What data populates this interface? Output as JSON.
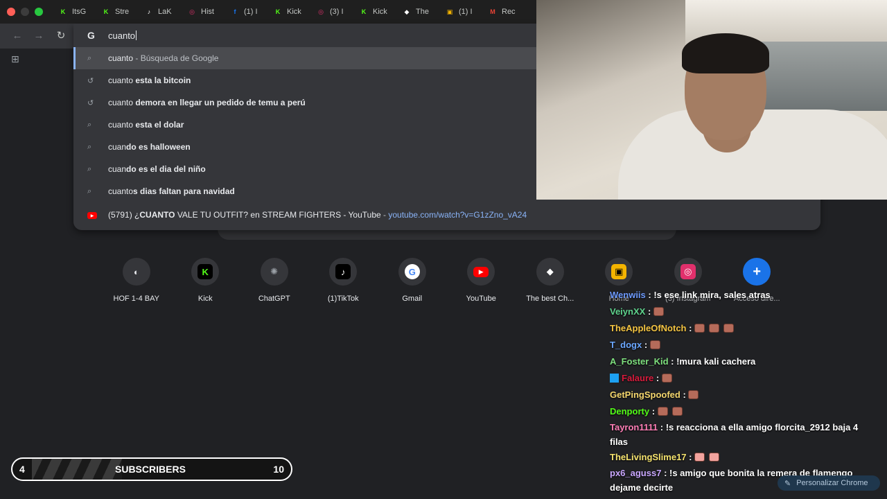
{
  "browser": {
    "tabs": [
      {
        "label": "ItsG",
        "icon": "kick-icon",
        "color": "#53fc18"
      },
      {
        "label": "Stre",
        "icon": "kick-icon",
        "color": "#53fc18"
      },
      {
        "label": "LaK",
        "icon": "tiktok-icon",
        "color": "#ffffff"
      },
      {
        "label": "Hist",
        "icon": "instagram-icon",
        "color": "#e1306c"
      },
      {
        "label": "(1) I",
        "icon": "facebook-icon",
        "color": "#1877f2"
      },
      {
        "label": "Kick",
        "icon": "kick-icon",
        "color": "#53fc18"
      },
      {
        "label": "(3) I",
        "icon": "instagram-icon",
        "color": "#e1306c"
      },
      {
        "label": "Kick",
        "icon": "kick-icon",
        "color": "#53fc18"
      },
      {
        "label": "The",
        "icon": "diamond-icon",
        "color": "#ffffff"
      },
      {
        "label": "(1) I",
        "icon": "clapper-icon",
        "color": "#f4b400"
      },
      {
        "label": "Rec",
        "icon": "gmail-icon",
        "color": "#ea4335"
      }
    ],
    "omnibox": {
      "query": "cuanto",
      "suggestions": [
        {
          "icon": "search-icon",
          "prefix": "cuanto",
          "rest": "",
          "suffix": " - Búsqueda de Google",
          "selected": true
        },
        {
          "icon": "history-icon",
          "prefix": "cuanto",
          "rest": " esta la bitcoin",
          "suffix": "",
          "selected": false
        },
        {
          "icon": "history-icon",
          "prefix": "cuanto",
          "rest": " demora en llegar un pedido de temu a perú",
          "suffix": "",
          "selected": false
        },
        {
          "icon": "search-icon",
          "prefix": "cuanto",
          "rest": " esta el dolar",
          "suffix": "",
          "selected": false
        },
        {
          "icon": "search-icon",
          "prefix": "cuan",
          "rest": "do es halloween",
          "suffix": "",
          "selected": false
        },
        {
          "icon": "search-icon",
          "prefix": "cuan",
          "rest": "do es el dia del niño",
          "suffix": "",
          "selected": false
        },
        {
          "icon": "search-icon",
          "prefix": "cuanto",
          "rest": "s dias faltan para navidad",
          "suffix": "",
          "selected": false
        }
      ],
      "history_result": {
        "title_before": "(5791) ¿",
        "title_bold": "CUANTO",
        "title_after": " VALE TU OUTFIT? en STREAM FIGHTERS - YouTube",
        "separator": " - ",
        "url": "youtube.com/watch?v=G1zZno_vA24"
      }
    }
  },
  "shortcuts": [
    {
      "label": "HOF 1-4 BAY",
      "icon": "hof-icon",
      "color": "#e8eaed"
    },
    {
      "label": "Kick",
      "icon": "kick-icon",
      "color": "#53fc18"
    },
    {
      "label": "ChatGPT",
      "icon": "chatgpt-icon",
      "color": "#9aa0a6"
    },
    {
      "label": "(1)TikTok",
      "icon": "tiktok-icon",
      "color": "#000000"
    },
    {
      "label": "Gmail",
      "icon": "google-icon",
      "color": "#ffffff"
    },
    {
      "label": "YouTube",
      "icon": "youtube-icon",
      "color": "#ff0000"
    },
    {
      "label": "The best Ch...",
      "icon": "diamond-icon",
      "color": "#ffffff"
    },
    {
      "label": "Home",
      "icon": "clapper-icon",
      "color": "#f4b400"
    },
    {
      "label": "(3) Instagram",
      "icon": "instagram-icon",
      "color": "#e1306c"
    },
    {
      "label": "Acceso dire...",
      "icon": "plus-icon",
      "color": "#1a73e8"
    }
  ],
  "chat": {
    "messages": [
      {
        "user": "Wenwiis",
        "color": "#6e9bff",
        "text": ": !s ese link mira, sales atras",
        "emotes": 0
      },
      {
        "user": "VeiynXX",
        "color": "#5fd38d",
        "text": ":",
        "emotes": 1
      },
      {
        "user": "TheAppleOfNotch",
        "color": "#f5c542",
        "text": ":",
        "emotes": 3
      },
      {
        "user": "T_dogx",
        "color": "#6ba7ff",
        "text": ":",
        "emotes": 1
      },
      {
        "user": "A_Foster_Kid",
        "color": "#7ee07e",
        "text": ": !mura kali cachera",
        "emotes": 0
      },
      {
        "user": "Falaure",
        "color": "#d81b3c",
        "text": ":",
        "emotes": 1
      },
      {
        "user": "GetPingSpoofed",
        "color": "#f5d76e",
        "text": ":",
        "emotes": 1
      },
      {
        "user": "Denporty",
        "color": "#53fc18",
        "text": ":",
        "emotes": 2
      },
      {
        "user": "Tayron1111",
        "color": "#ff7eb6",
        "text": ": !s reacciona a ella amigo florcita_2912 baja 4 filas",
        "emotes": 0
      },
      {
        "user": "TheLivingSlime17",
        "color": "#f5e36e",
        "text": ":",
        "emotes": 2
      },
      {
        "user": "px6_aguss7",
        "color": "#c9a7ff",
        "text": ": !s amigo que bonita la remera de flamengo dejame decirte",
        "emotes": 0
      }
    ]
  },
  "subscribers": {
    "current": "4",
    "label": "SUBSCRIBERS",
    "goal": "10"
  },
  "customize_chrome": "Personalizar Chrome"
}
